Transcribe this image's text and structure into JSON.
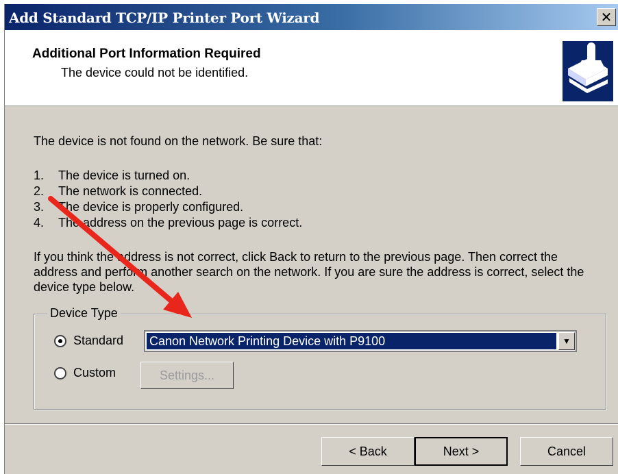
{
  "window": {
    "title": "Add Standard TCP/IP Printer Port Wizard",
    "close_glyph": "✕"
  },
  "header": {
    "title": "Additional Port Information Required",
    "subtitle": "The device could not be identified.",
    "icon": "printer-network-icon"
  },
  "content": {
    "intro": "The device is not found on the network.  Be sure that:",
    "checklist": [
      {
        "num": "1.",
        "text": "The device is turned on."
      },
      {
        "num": "2.",
        "text": "The network is connected."
      },
      {
        "num": "3.",
        "text": "The device is properly configured."
      },
      {
        "num": "4.",
        "text": "The address on the previous page is correct."
      }
    ],
    "paragraph": "If you think the address is not correct, click Back to return to the previous page.  Then correct the address and perform another search on the network.  If you are sure the address is correct, select the device type below."
  },
  "device_type": {
    "group_label": "Device Type",
    "standard_label": "Standard",
    "custom_label": "Custom",
    "selected": "standard",
    "standard_value": "Canon Network Printing Device with P9100",
    "settings_label": "Settings..."
  },
  "footer": {
    "back_label": "< Back",
    "next_label": "Next >",
    "cancel_label": "Cancel"
  },
  "colors": {
    "title_bar_start": "#0a246a",
    "selection": "#0a246a",
    "annotation_arrow": "#e8261c"
  }
}
